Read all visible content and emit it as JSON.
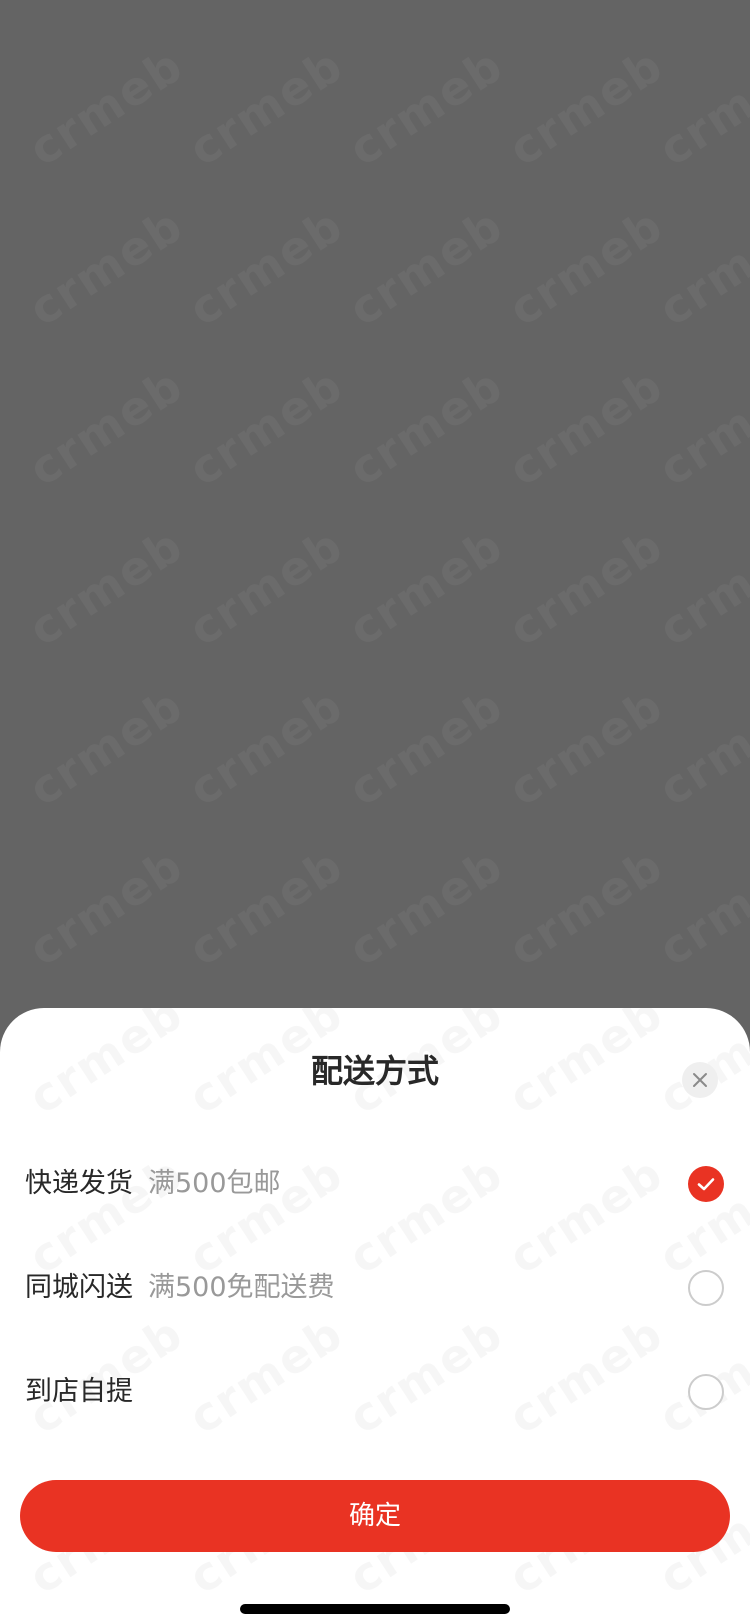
{
  "modal": {
    "title": "配送方式",
    "close_icon": "close-icon",
    "options": [
      {
        "label": "快递发货",
        "desc": "满500包邮",
        "selected": true
      },
      {
        "label": "同城闪送",
        "desc": "满500免配送费",
        "selected": false
      },
      {
        "label": "到店自提",
        "desc": "",
        "selected": false
      }
    ],
    "confirm_label": "确定"
  },
  "watermark": {
    "text": "crmeb"
  },
  "colors": {
    "accent": "#e93323",
    "overlay": "#646464",
    "text_primary": "#282828",
    "text_secondary": "#999999"
  }
}
